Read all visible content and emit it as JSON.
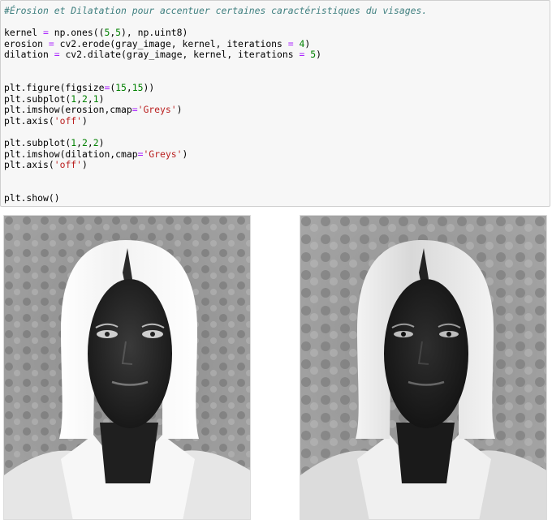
{
  "code_cell": {
    "lines": [
      [
        {
          "t": "#Érosion et Dilatation pour accentuer certaines caractéristiques du visages.",
          "c": "cm"
        }
      ],
      [],
      [
        {
          "t": "kernel "
        },
        {
          "t": "=",
          "c": "op"
        },
        {
          "t": " np.ones(("
        },
        {
          "t": "5",
          "c": "num"
        },
        {
          "t": ","
        },
        {
          "t": "5",
          "c": "num"
        },
        {
          "t": "), np.uint8)"
        }
      ],
      [
        {
          "t": "erosion "
        },
        {
          "t": "=",
          "c": "op"
        },
        {
          "t": " cv2.erode(gray_image, kernel, iterations "
        },
        {
          "t": "=",
          "c": "op"
        },
        {
          "t": " "
        },
        {
          "t": "4",
          "c": "num"
        },
        {
          "t": ")"
        }
      ],
      [
        {
          "t": "dilation "
        },
        {
          "t": "=",
          "c": "op"
        },
        {
          "t": " cv2.dilate(gray_image, kernel, iterations "
        },
        {
          "t": "=",
          "c": "op"
        },
        {
          "t": " "
        },
        {
          "t": "5",
          "c": "num"
        },
        {
          "t": ")"
        }
      ],
      [],
      [],
      [
        {
          "t": "plt.figure(figsize"
        },
        {
          "t": "=",
          "c": "op"
        },
        {
          "t": "("
        },
        {
          "t": "15",
          "c": "num"
        },
        {
          "t": ","
        },
        {
          "t": "15",
          "c": "num"
        },
        {
          "t": "))"
        }
      ],
      [
        {
          "t": "plt.subplot("
        },
        {
          "t": "1",
          "c": "num"
        },
        {
          "t": ","
        },
        {
          "t": "2",
          "c": "num"
        },
        {
          "t": ","
        },
        {
          "t": "1",
          "c": "num"
        },
        {
          "t": ")"
        }
      ],
      [
        {
          "t": "plt.imshow(erosion,cmap"
        },
        {
          "t": "=",
          "c": "op"
        },
        {
          "t": "'Greys'",
          "c": "str"
        },
        {
          "t": ")"
        }
      ],
      [
        {
          "t": "plt.axis("
        },
        {
          "t": "'off'",
          "c": "str"
        },
        {
          "t": ")"
        }
      ],
      [],
      [
        {
          "t": "plt.subplot("
        },
        {
          "t": "1",
          "c": "num"
        },
        {
          "t": ","
        },
        {
          "t": "2",
          "c": "num"
        },
        {
          "t": ","
        },
        {
          "t": "2",
          "c": "num"
        },
        {
          "t": ")"
        }
      ],
      [
        {
          "t": "plt.imshow(dilation,cmap"
        },
        {
          "t": "=",
          "c": "op"
        },
        {
          "t": "'Greys'",
          "c": "str"
        },
        {
          "t": ")"
        }
      ],
      [
        {
          "t": "plt.axis("
        },
        {
          "t": "'off'",
          "c": "str"
        },
        {
          "t": ")"
        }
      ],
      [],
      [],
      [
        {
          "t": "plt.show()"
        }
      ]
    ]
  },
  "output": {
    "images": [
      {
        "name": "erosion",
        "variant": "erosion"
      },
      {
        "name": "dilation",
        "variant": "dilation"
      }
    ]
  },
  "colors": {
    "cell_background": "#f7f7f7",
    "cell_border": "#cfcfcf",
    "comment": "#408080",
    "operator": "#aa22ff",
    "number": "#008000",
    "string": "#ba2121"
  }
}
